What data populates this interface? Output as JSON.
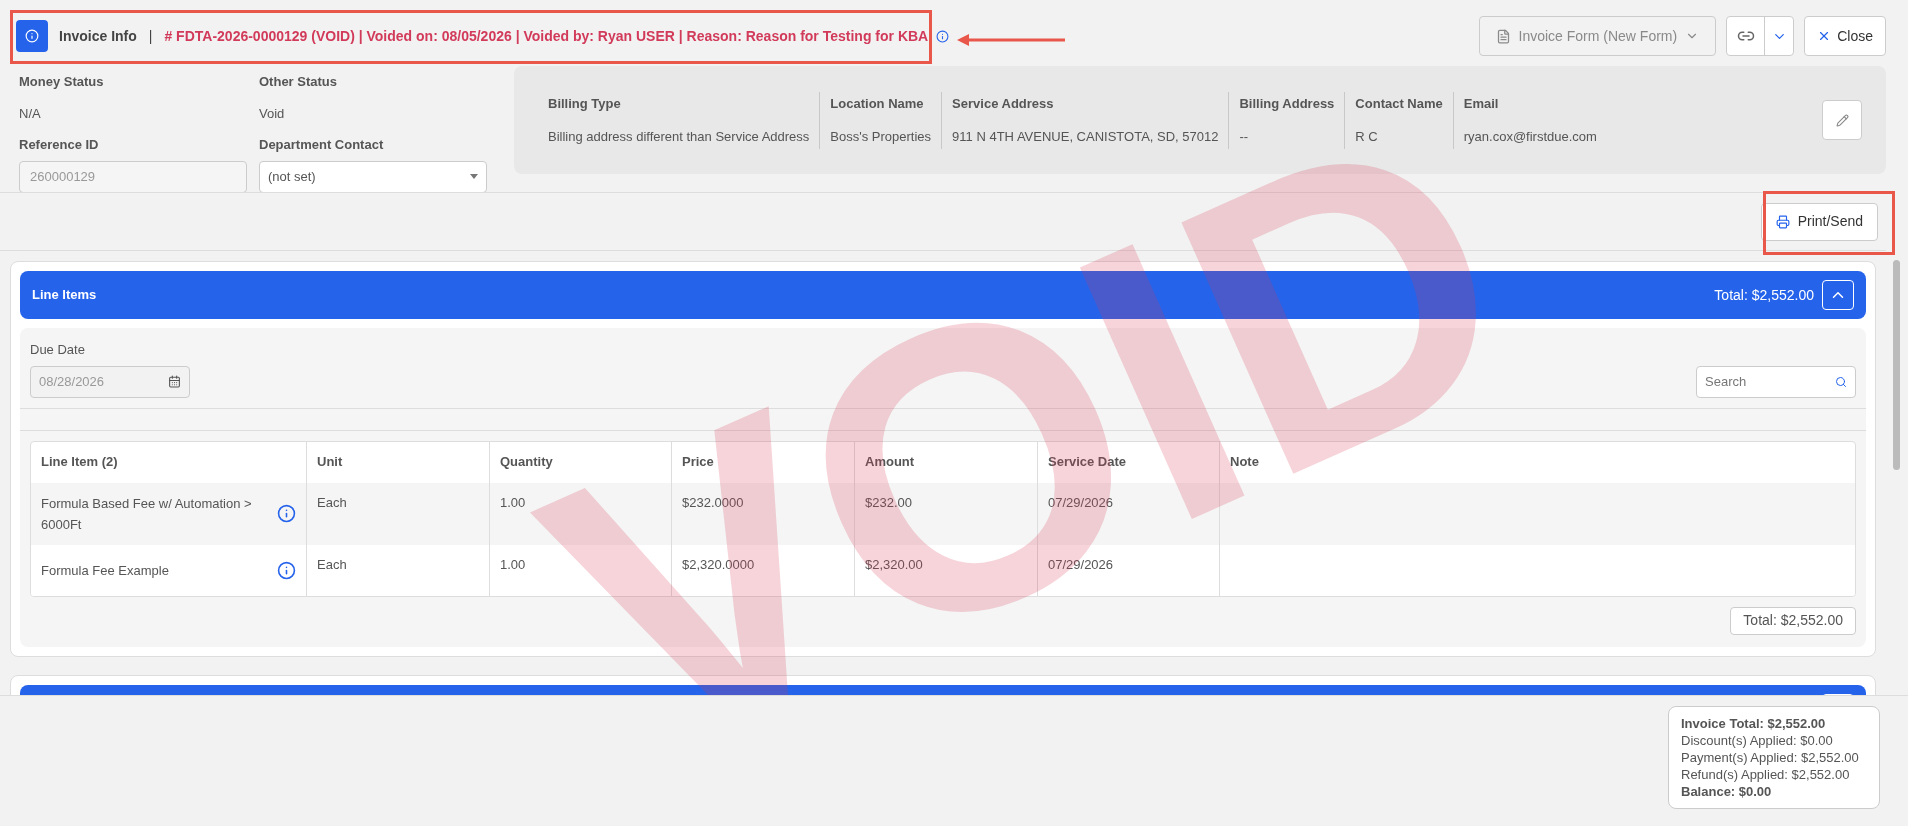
{
  "header": {
    "title": "Invoice Info",
    "separator": "|",
    "void_notice": "# FDTA-2026-0000129 (VOID) | Voided on: 08/05/2026 | Voided by: Ryan USER | Reason: Reason for Testing for KBA"
  },
  "toolbar": {
    "form_select": {
      "value": "Invoice Form (New Form)",
      "disabled": true
    },
    "close": "Close"
  },
  "status": [
    {
      "label": "Money Status",
      "value": "N/A"
    },
    {
      "label": "Other Status",
      "value": "Void"
    }
  ],
  "reference_id": {
    "label": "Reference ID",
    "value": "260000129"
  },
  "department_contact": {
    "label": "Department Contact",
    "value": "(not set)"
  },
  "billing": [
    {
      "label": "Billing Type",
      "value": "Billing address different than Service Address"
    },
    {
      "label": "Location Name",
      "value": "Boss's Properties"
    },
    {
      "label": "Service Address",
      "value": "911 N 4TH AVENUE, CANISTOTA, SD, 57012"
    },
    {
      "label": "Billing Address",
      "value": "--"
    },
    {
      "label": "Contact Name",
      "value": "R C"
    },
    {
      "label": "Email",
      "value": "ryan.cox@firstdue.com"
    }
  ],
  "print_button": "Print/Send",
  "line_items": {
    "title": "Line Items",
    "total": "Total: $2,552.00",
    "expanded": true,
    "due_date": {
      "label": "Due Date",
      "value": "08/28/2026"
    },
    "search": {
      "placeholder": "Search"
    },
    "columns": [
      "Line Item (2)",
      "Unit",
      "Quantity",
      "Price",
      "Amount",
      "Service Date",
      "Note"
    ],
    "rows": [
      {
        "cells": [
          "Formula Based Fee w/ Automation >6000Ft",
          "Each",
          "1.00",
          "$232.0000",
          "$232.00",
          "07/29/2026",
          ""
        ]
      },
      {
        "cells": [
          "Formula Fee Example",
          "Each",
          "1.00",
          "$2,320.0000",
          "$2,320.00",
          "07/29/2026",
          ""
        ]
      }
    ],
    "footer_total": "Total: $2,552.00"
  },
  "summary": [
    {
      "text": "Invoice Total: $2,552.00",
      "bold": true
    },
    {
      "text": "Discount(s) Applied: $0.00",
      "bold": false
    },
    {
      "text": "Payment(s) Applied: $2,552.00",
      "bold": false
    },
    {
      "text": "Refund(s) Applied: $2,552.00",
      "bold": false
    },
    {
      "text": "Balance: $0.00",
      "bold": true
    }
  ],
  "void_stamp": "VOID"
}
